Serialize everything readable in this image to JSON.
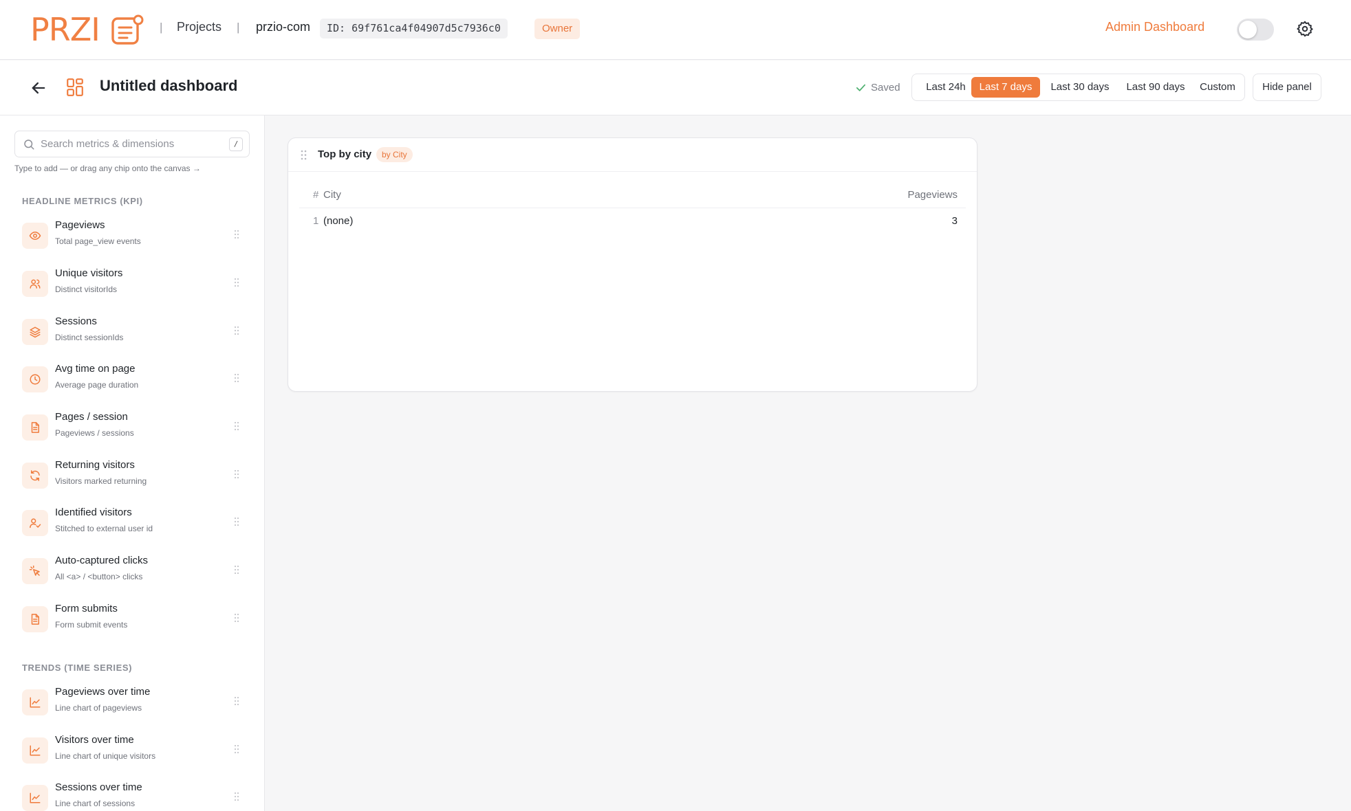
{
  "topnav": {
    "logo_text": "PRZI",
    "projects_link": "Projects",
    "separator": "|",
    "project_name": "przio-com",
    "project_id": "ID: 69f761ca4f04907d5c7936c0",
    "role_badge": "Owner",
    "admin_link": "Admin Dashboard",
    "accent_color": "#ef7b3c"
  },
  "dashboard": {
    "title": "Untitled dashboard",
    "saved_status": "Saved",
    "ranges": [
      "Last 24h",
      "Last 7 days",
      "Last 30 days",
      "Last 90 days",
      "Custom"
    ],
    "active_range": "Last 7 days",
    "hide_panel_label": "Hide panel"
  },
  "sidebar": {
    "search_placeholder": "Search metrics & dimensions",
    "search_shortcut": "/",
    "hint": "Type to add — or drag any chip onto the canvas →",
    "sections": [
      {
        "title": "HEADLINE METRICS (KPI)",
        "items": [
          {
            "name": "Pageviews",
            "desc": "Total page_view events",
            "icon": "eye-icon"
          },
          {
            "name": "Unique visitors",
            "desc": "Distinct visitorIds",
            "icon": "users-icon"
          },
          {
            "name": "Sessions",
            "desc": "Distinct sessionIds",
            "icon": "layers-icon"
          },
          {
            "name": "Avg time on page",
            "desc": "Average page duration",
            "icon": "clock-icon"
          },
          {
            "name": "Pages / session",
            "desc": "Pageviews / sessions",
            "icon": "document-icon"
          },
          {
            "name": "Returning visitors",
            "desc": "Visitors marked returning",
            "icon": "refresh-icon"
          },
          {
            "name": "Identified visitors",
            "desc": "Stitched to external user id",
            "icon": "user-check-icon"
          },
          {
            "name": "Auto-captured clicks",
            "desc": "All <a> / <button> clicks",
            "icon": "pointer-click-icon"
          },
          {
            "name": "Form submits",
            "desc": "Form submit events",
            "icon": "form-icon"
          }
        ]
      },
      {
        "title": "TRENDS (TIME SERIES)",
        "items": [
          {
            "name": "Pageviews over time",
            "desc": "Line chart of pageviews",
            "icon": "line-chart-icon"
          },
          {
            "name": "Visitors over time",
            "desc": "Line chart of unique visitors",
            "icon": "line-chart-icon"
          },
          {
            "name": "Sessions over time",
            "desc": "Line chart of sessions",
            "icon": "line-chart-icon"
          }
        ]
      }
    ]
  },
  "card": {
    "title": "Top by city",
    "badge": "by City",
    "columns": {
      "rank": "#",
      "name": "City",
      "value": "Pageviews"
    },
    "rows": [
      {
        "rank": "1",
        "name": "(none)",
        "value": "3"
      }
    ]
  }
}
